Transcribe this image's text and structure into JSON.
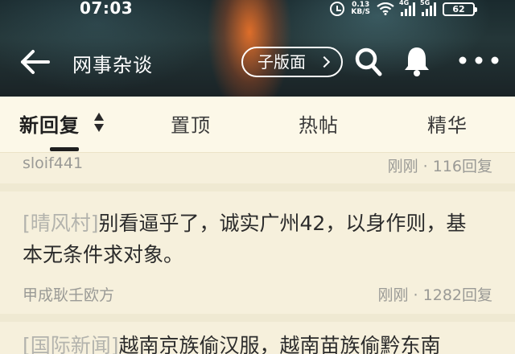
{
  "status_bar": {
    "time": "07:03",
    "net_speed_value": "0.13",
    "net_speed_unit": "KB/S",
    "signal_1_tag": "4G",
    "signal_2_tag": "5G",
    "battery": "62"
  },
  "nav": {
    "title": "网事杂谈",
    "subforum_label": "子版面"
  },
  "tabs": [
    {
      "label": "新回复",
      "active": true
    },
    {
      "label": "置顶",
      "active": false
    },
    {
      "label": "热帖",
      "active": false
    },
    {
      "label": "精华",
      "active": false
    }
  ],
  "posts": [
    {
      "author": "sloif441",
      "time": "刚刚",
      "replies": "116回复"
    },
    {
      "tag": "[晴风村]",
      "title": "别看逼乎了，诚实广州42，以身作则，基本无条件求对象。",
      "author": "甲成耿壬欧方",
      "time": "刚刚",
      "replies": "1282回复"
    },
    {
      "tag": "[国际新闻]",
      "title": "越南京族偷汉服，越南苗族偷黔东南"
    }
  ],
  "colors": {
    "background": "#f6f0dc",
    "tab_bar": "#fcf8e8",
    "text_primary": "#2b2b2b",
    "text_muted": "#9a9a96",
    "tag": "#b3b3ad"
  }
}
